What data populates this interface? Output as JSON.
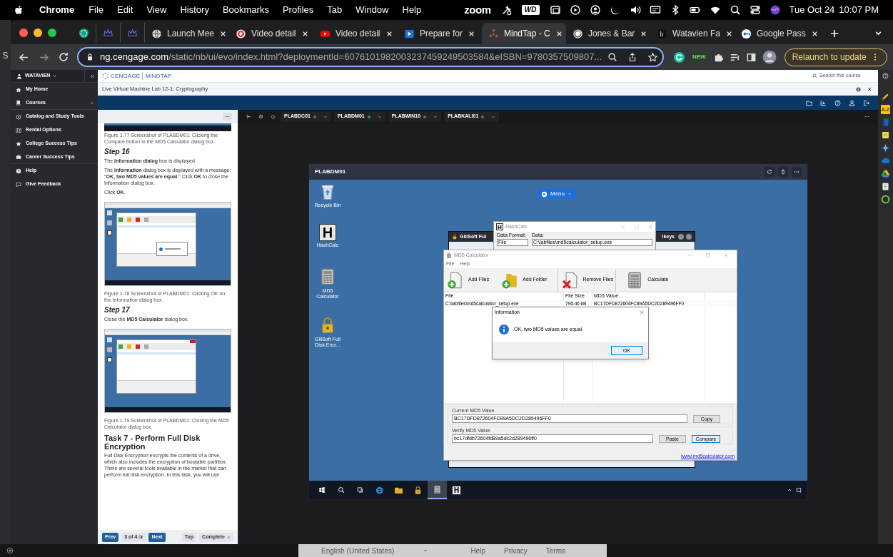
{
  "menu_bar": {
    "app": "Chrome",
    "items": [
      "File",
      "Edit",
      "View",
      "History",
      "Bookmarks",
      "Profiles",
      "Tab",
      "Window",
      "Help"
    ],
    "zoom_label": "zoom",
    "drive_label": "WD",
    "date": "Tue Oct 24",
    "time": "10:07 PM"
  },
  "background_window": {
    "text": "S"
  },
  "browser": {
    "tabs": [
      {
        "kind": "icon",
        "selected": false
      },
      {
        "kind": "icon",
        "selected": false
      },
      {
        "kind": "icon",
        "selected": false
      },
      {
        "kind": "text",
        "label": "Launch Mee",
        "selected": false
      },
      {
        "kind": "text",
        "label": "Video detail",
        "selected": false
      },
      {
        "kind": "text",
        "label": "Video detail",
        "selected": false
      },
      {
        "kind": "text",
        "label": "Prepare for",
        "selected": false
      },
      {
        "kind": "text",
        "label": "MindTap - C",
        "selected": true
      },
      {
        "kind": "text",
        "label": "Jones & Bar",
        "selected": false
      },
      {
        "kind": "text",
        "label": "Watavien Fa",
        "selected": false
      },
      {
        "kind": "text",
        "label": "Google Pass",
        "selected": false
      }
    ],
    "new_tab": "+",
    "url_host": "ng.cengage.com",
    "url_rest": "/static/nb/ui/evo/index.html?deploymentId=6076101982003237459249503584&eISBN=9780357509807...",
    "extension_badge": "NEW",
    "relaunch": "Relaunch to update"
  },
  "sidebar": {
    "user": "WATAVIEN",
    "items": [
      {
        "label": "My Home",
        "kind": "link"
      },
      {
        "label": "Courses",
        "kind": "group"
      },
      {
        "label": "Catalog and Study Tools",
        "kind": "link"
      },
      {
        "label": "Rental Options",
        "kind": "link"
      },
      {
        "label": "College Success Tips",
        "kind": "link"
      },
      {
        "label": "Career Success Tips",
        "kind": "link"
      },
      {
        "label": "Help",
        "kind": "link"
      },
      {
        "label": "Give Feedback",
        "kind": "link"
      }
    ]
  },
  "header": {
    "logo_left": "CENGAGE",
    "logo_right": "MINDTAP",
    "search_placeholder": "Search this course"
  },
  "activity": {
    "title": "Live Virtual Machine Lab 12-1: Cryptography"
  },
  "article": {
    "blocks": [
      {
        "kind": "figure_tail"
      },
      {
        "kind": "caption",
        "text": "Figure 1.77 Screenshot of PLABDM01: Clicking the Compare button in the MD5 Calculator dialog box."
      },
      {
        "kind": "step",
        "text": "Step 16"
      },
      {
        "kind": "para",
        "text": "The **Information dialog** box is displayed."
      },
      {
        "kind": "para",
        "text": "The **Information** dialog box is displayed with a message: \"**OK, two MD5 values are equal**.\" Click **OK** to close the Information dialog box."
      },
      {
        "kind": "para",
        "text": "Click **OK**."
      },
      {
        "kind": "figure"
      },
      {
        "kind": "caption",
        "text": "Figure 1.78 Screenshot of PLABDM01: Clicking OK on the Information dialog box."
      },
      {
        "kind": "step",
        "text": "Step 17"
      },
      {
        "kind": "para",
        "text": "Close the **MD5 Calculator** dialog box."
      },
      {
        "kind": "figure"
      },
      {
        "kind": "caption",
        "text": "Figure 1.79 Screenshot of PLABDM01: Closing the MD5 Calculator dialog box."
      },
      {
        "kind": "heading",
        "text": "Task 7 - Perform Full Disk Encryption"
      },
      {
        "kind": "para",
        "text": "Full Disk Encryption encrypts the contents of a drive, which also includes the encryption of bootable partition. There are several tools available in the market that can perform full disk encryption. In this task, you will use"
      }
    ],
    "nav": {
      "prev": "Prev",
      "page": "3 of 4",
      "next": "Next",
      "top": "Top",
      "complete": "Complete"
    }
  },
  "vm": {
    "machines": [
      {
        "name": "PLABDC01",
        "color": "#6b6b6b"
      },
      {
        "name": "PLABDM01",
        "color": "#1fa33a"
      },
      {
        "name": "PLABWIN10",
        "color": "#6b6b6b"
      },
      {
        "name": "PLABKALI01",
        "color": "#6b6b6b"
      }
    ],
    "window": {
      "title": "PLABDM01",
      "menu": "Menu",
      "desktop_icons": [
        {
          "label": "Recycle Bin"
        },
        {
          "label": "HashCalc",
          "glyph": "H"
        },
        {
          "label": "MD5 Calculator"
        },
        {
          "label": "GiliSoft Full Disk Encr..."
        }
      ],
      "gilisoft": {
        "title": "GiliSoft Ful",
        "title_right": "lkeys"
      },
      "hashcalc": {
        "title": "HashCalc",
        "glyph": "H",
        "data_format_label": "Data Format:",
        "data_label": "Data:",
        "format_value": "File",
        "data_value": "C:\\labfiles\\md5calculator_setup.exe"
      },
      "md5": {
        "title": "MD5 Calculator",
        "menu": [
          "File",
          "Help"
        ],
        "toolbar": [
          "Add Files",
          "Add Folder",
          "Remove Files",
          "Calculate"
        ],
        "columns": [
          "File",
          "File Size",
          "MD5 Value"
        ],
        "row": [
          "C:\\labfiles\\md5calculator_setup.exe",
          "796.46 kB",
          "BC17DFD872604FC89A5DC2D289496FF0"
        ],
        "current_label": "Current MD5 Value",
        "current_value": "BC17DFD872604FC89A5DC2D289496FF0",
        "copy": "Copy",
        "verify_label": "Verify MD5 Value",
        "verify_value": "bc17dfdb72604fd89a5dc2d289496ff0",
        "paste": "Paste",
        "compare": "Compare",
        "link": "www.md5calculator.com"
      },
      "info": {
        "title": "Information",
        "message": "OK, two MD5 values are equal.",
        "ok": "OK"
      },
      "taskbar": [
        {
          "selected": false
        },
        {
          "selected": false
        },
        {
          "selected": false
        },
        {
          "selected": false
        },
        {
          "selected": false
        },
        {
          "selected": false
        },
        {
          "selected": true
        },
        {
          "glyph": "H",
          "selected": false
        }
      ]
    }
  },
  "extensions": {
    "az_label": "A-Z"
  },
  "footer": {
    "language": "English (United States)",
    "links": [
      "Help",
      "Privacy",
      "Terms"
    ]
  }
}
